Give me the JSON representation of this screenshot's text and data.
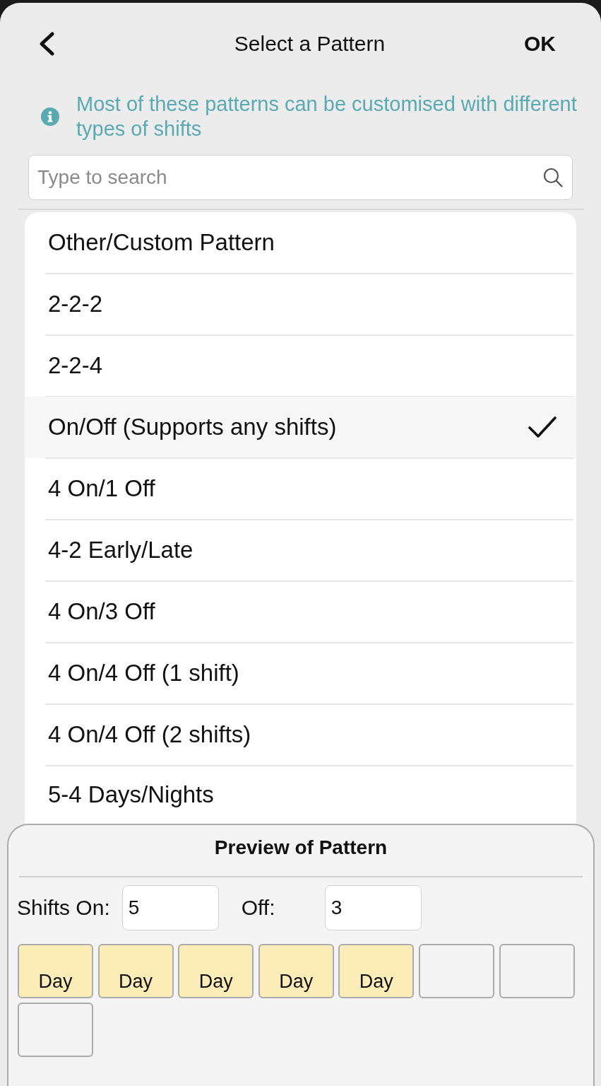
{
  "header": {
    "title": "Select a Pattern",
    "action": "OK"
  },
  "info": {
    "text": "Most of these patterns can be customised with different types of shifts"
  },
  "search": {
    "placeholder": "Type to search"
  },
  "patterns": [
    {
      "label": "Other/Custom Pattern",
      "selected": false
    },
    {
      "label": "2-2-2",
      "selected": false
    },
    {
      "label": "2-2-4",
      "selected": false
    },
    {
      "label": "On/Off (Supports any shifts)",
      "selected": true
    },
    {
      "label": "4 On/1 Off",
      "selected": false
    },
    {
      "label": "4-2 Early/Late",
      "selected": false
    },
    {
      "label": "4 On/3 Off",
      "selected": false
    },
    {
      "label": "4 On/4 Off (1 shift)",
      "selected": false
    },
    {
      "label": "4 On/4 Off (2 shifts)",
      "selected": false
    },
    {
      "label": "5-4 Days/Nights",
      "selected": false
    }
  ],
  "preview": {
    "title": "Preview of Pattern",
    "shifts_on": {
      "label": "Shifts On:",
      "value": "5"
    },
    "off": {
      "label": "Off:",
      "value": "3"
    },
    "days": [
      {
        "kind": "shift",
        "label": "Day"
      },
      {
        "kind": "shift",
        "label": "Day"
      },
      {
        "kind": "shift",
        "label": "Day"
      },
      {
        "kind": "shift",
        "label": "Day"
      },
      {
        "kind": "shift",
        "label": "Day"
      },
      {
        "kind": "off"
      },
      {
        "kind": "off"
      },
      {
        "kind": "off"
      }
    ]
  }
}
